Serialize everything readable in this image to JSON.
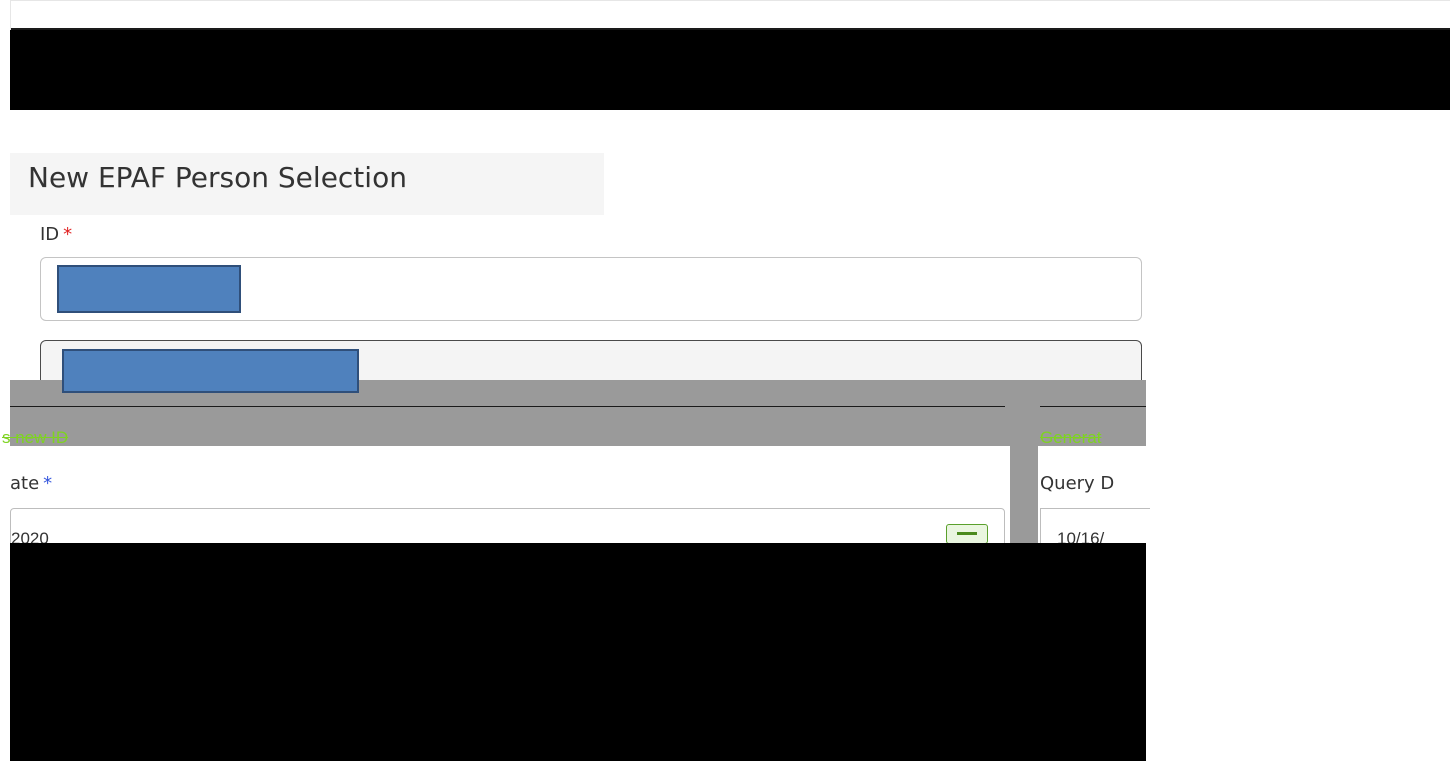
{
  "page": {
    "title": "New EPAF Person Selection"
  },
  "id_field": {
    "label": "ID",
    "required_mark": "*"
  },
  "new_id_panel": {
    "link_text": "s new ID",
    "date_label": "ate",
    "date_required_mark": "*",
    "date_value": "2020"
  },
  "generate_panel": {
    "link_text": "Generat",
    "query_label": "Query D",
    "query_value": "10/16/"
  },
  "colors": {
    "required_red": "#e02020",
    "required_blue": "#3355dd",
    "link_green": "#7ed321",
    "redaction_blue": "#4f81bd"
  }
}
